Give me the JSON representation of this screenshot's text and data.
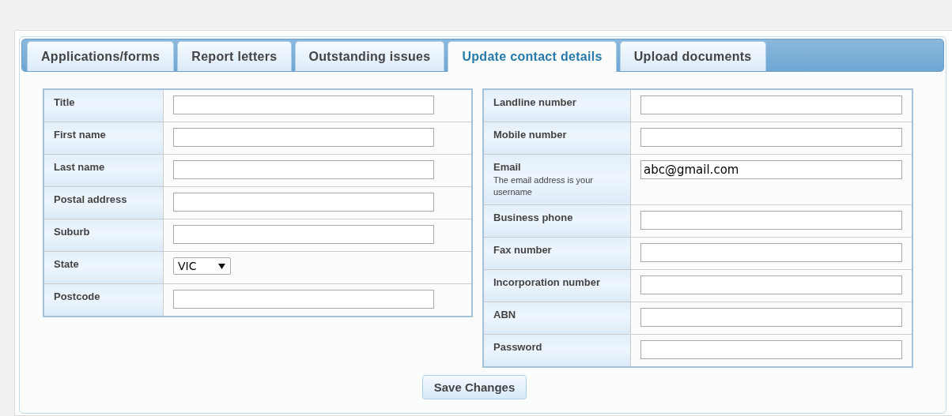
{
  "tabs": [
    {
      "label": "Applications/forms",
      "selected": false
    },
    {
      "label": "Report letters",
      "selected": false
    },
    {
      "label": "Outstanding issues",
      "selected": false
    },
    {
      "label": "Update contact details",
      "selected": true
    },
    {
      "label": "Upload documents",
      "selected": false
    }
  ],
  "left_form": {
    "fields": [
      {
        "label": "Title",
        "kind": "text"
      },
      {
        "label": "First name",
        "kind": "text"
      },
      {
        "label": "Last name",
        "kind": "text"
      },
      {
        "label": "Postal address",
        "kind": "text"
      },
      {
        "label": "Suburb",
        "kind": "text"
      },
      {
        "label": "State",
        "kind": "select",
        "value": "VIC"
      },
      {
        "label": "Postcode",
        "kind": "text"
      }
    ]
  },
  "right_form": {
    "fields": [
      {
        "label": "Landline number",
        "kind": "text"
      },
      {
        "label": "Mobile number",
        "kind": "text"
      },
      {
        "label": "Email",
        "kind": "text",
        "note": "The email address is your username",
        "value": "abc@gmail.com"
      },
      {
        "label": "Business phone",
        "kind": "text"
      },
      {
        "label": "Fax number",
        "kind": "text"
      },
      {
        "label": "Incorporation number",
        "kind": "text"
      },
      {
        "label": "ABN",
        "kind": "text"
      },
      {
        "label": "Password",
        "kind": "text"
      }
    ]
  },
  "save_button": "Save Changes"
}
